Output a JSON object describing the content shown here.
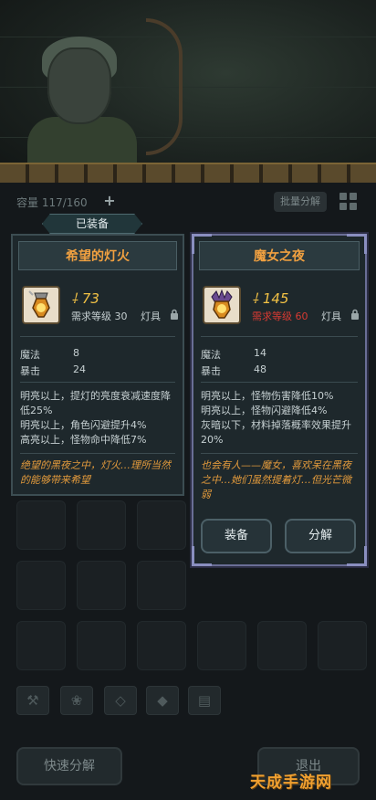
{
  "inventory": {
    "capacity_text": "容量 117/160",
    "add_label": "+",
    "batch_label": "批量分解"
  },
  "equipped_badge": "已装备",
  "left_card": {
    "name": "希望的灯火",
    "power": "73",
    "requirement": "需求等级 30",
    "category": "灯具",
    "stats": [
      {
        "name": "魔法",
        "value": "8"
      },
      {
        "name": "暴击",
        "value": "24"
      }
    ],
    "effects": [
      "明亮以上，提灯的亮度衰减速度降低25%",
      "明亮以上，角色闪避提升4%",
      "高亮以上，怪物命中降低7%"
    ],
    "flavor": "绝望的黑夜之中，灯火…理所当然的能够带来希望"
  },
  "right_card": {
    "name": "魔女之夜",
    "power": "145",
    "requirement": "需求等级 60",
    "requirement_color": "#d83a32",
    "category": "灯具",
    "stats": [
      {
        "name": "魔法",
        "value": "14"
      },
      {
        "name": "暴击",
        "value": "48"
      }
    ],
    "effects": [
      "明亮以上，怪物伤害降低10%",
      "明亮以上，怪物闪避降低4%",
      "灰暗以下，材料掉落概率效果提升20%"
    ],
    "flavor": "也会有人——魔女，喜欢呆在黑夜之中…她们虽然提着灯…但光芒微弱",
    "equip_label": "装备",
    "decompose_label": "分解"
  },
  "filters": [
    "hammer-icon",
    "paw-icon",
    "gem-icon",
    "ore-icon",
    "chest-icon"
  ],
  "bottom": {
    "quick_decompose": "快速分解",
    "exit": "退出"
  },
  "watermark": "天成手游网",
  "colors": {
    "accent": "#f0a040",
    "power": "#f3c245",
    "flavor": "#e29a3c"
  }
}
